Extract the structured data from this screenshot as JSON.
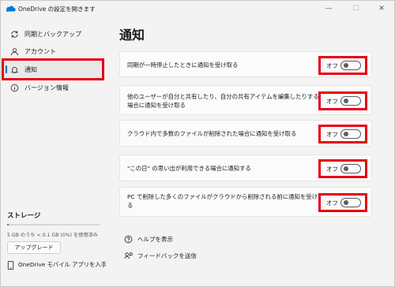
{
  "window": {
    "title": "OneDrive の設定を開きます",
    "minimize_glyph": "—",
    "maximize_glyph": "☐",
    "close_glyph": "✕"
  },
  "sidebar": {
    "items": [
      {
        "label": "同期とバックアップ",
        "icon": "sync-icon"
      },
      {
        "label": "アカウント",
        "icon": "person-icon"
      },
      {
        "label": "通知",
        "icon": "bell-icon",
        "selected": true
      },
      {
        "label": "バージョン情報",
        "icon": "info-icon"
      }
    ],
    "storage": {
      "title": "ストレージ",
      "usage_text": "5 GB のうち < 0.1 GB (0%) を使用済み",
      "used_fraction": 0.01,
      "upgrade_label": "アップグレード"
    },
    "mobile_link": "OneDrive モバイル アプリを入手"
  },
  "main": {
    "title": "通知",
    "settings": [
      {
        "label_lines": [
          "同期が一時停止したときに通知を受け取る"
        ],
        "state_label": "オフ",
        "on": false
      },
      {
        "label_lines": [
          "他のユーザーが自分と共有したり、自分の共有アイテムを編集したりする",
          "場合に通知を受け取る"
        ],
        "state_label": "オフ",
        "on": false
      },
      {
        "label_lines": [
          "クラウド内で多数のファイルが削除された場合に通知を受け取る"
        ],
        "state_label": "オフ",
        "on": false
      },
      {
        "label_lines": [
          "\"この日\" の思い出が利用できる場合に通知する"
        ],
        "state_label": "オフ",
        "on": false
      },
      {
        "label_lines": [
          "PC で削除した多くのファイルがクラウドから削除される前に通知を受け取",
          "る"
        ],
        "state_label": "オフ",
        "on": false
      }
    ],
    "help_links": [
      {
        "label": "ヘルプを表示",
        "icon": "help-icon"
      },
      {
        "label": "フィードバックを送信",
        "icon": "feedback-icon"
      }
    ]
  },
  "colors": {
    "accent": "#0067c0",
    "highlight_box": "#e60012",
    "window_bg": "#f3f3f3",
    "card_bg": "#fbfbfb"
  }
}
